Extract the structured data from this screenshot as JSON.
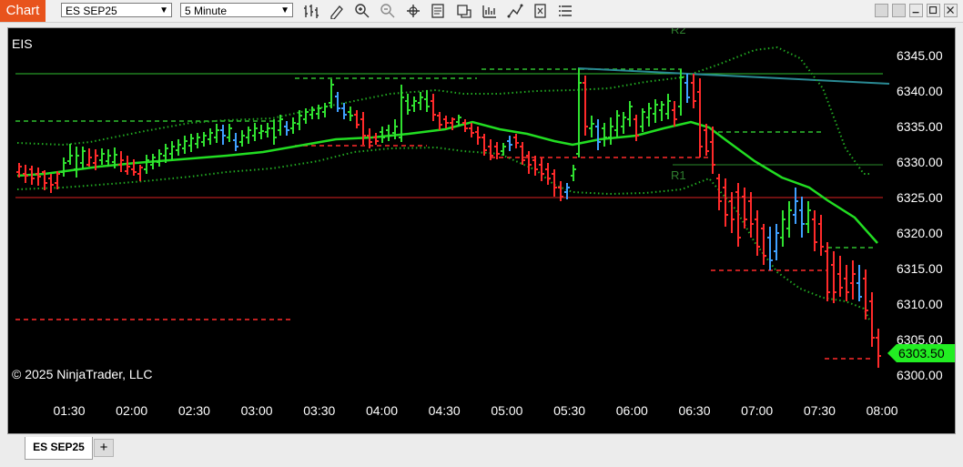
{
  "toolbar": {
    "chart_label": "Chart",
    "instrument": "ES SEP25",
    "interval": "5 Minute",
    "tools": [
      "bar-type-icon",
      "draw-icon",
      "zoom-in-icon",
      "zoom-out-icon",
      "crosshair-icon",
      "data-box-icon",
      "strategies-icon",
      "indicators-icon",
      "drawing-tools-icon",
      "properties-icon",
      "more-icon"
    ]
  },
  "chart": {
    "instrument_label": "EIS",
    "copyright": "© 2025 NinjaTrader, LLC",
    "price_ticks": [
      "6345.00",
      "6340.00",
      "6335.00",
      "6330.00",
      "6325.00",
      "6320.00",
      "6315.00",
      "6310.00",
      "6305.00",
      "6300.00"
    ],
    "time_ticks": [
      "01:30",
      "02:00",
      "02:30",
      "03:00",
      "03:30",
      "04:00",
      "04:30",
      "05:00",
      "05:30",
      "06:00",
      "06:30",
      "07:00",
      "07:30",
      "08:00"
    ],
    "last_price": "6303.50",
    "pivot_labels": {
      "r2": "R2",
      "r1": "R1"
    },
    "colors": {
      "background": "#000000",
      "up_bar": "#30e030",
      "down_bar": "#ff2a2a",
      "neutral_bar": "#3fa0ff",
      "ma_line": "#22dd22",
      "trend_line": "#2a8a94",
      "price_marker": "#22ee22"
    }
  },
  "tabs": {
    "instrument_tab": "ES SEP25",
    "add_tab": "+"
  }
}
